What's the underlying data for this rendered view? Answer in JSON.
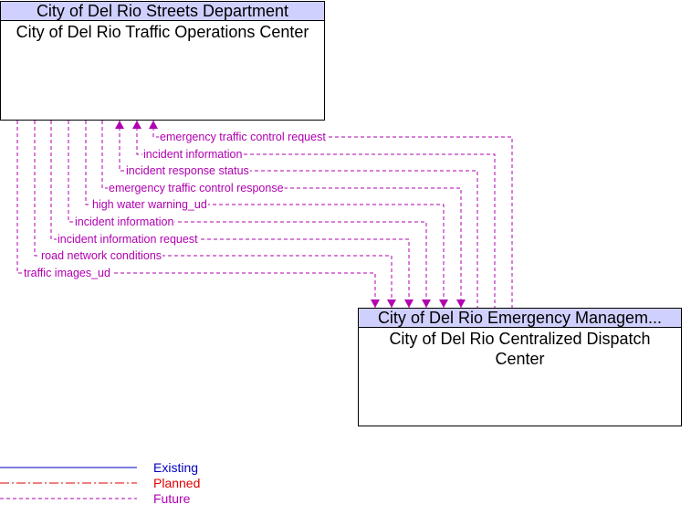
{
  "top_box": {
    "header": "City of Del Rio Streets Department",
    "title": "City of Del Rio Traffic Operations Center"
  },
  "bottom_box": {
    "header": "City of Del Rio Emergency Managem...",
    "title": "City of Del Rio Centralized Dispatch Center"
  },
  "flows": [
    {
      "label": "emergency traffic control request",
      "direction": "to-top",
      "status": "Future"
    },
    {
      "label": "incident information",
      "direction": "to-top",
      "status": "Future"
    },
    {
      "label": "incident response status",
      "direction": "to-top",
      "status": "Future"
    },
    {
      "label": "emergency traffic control response",
      "direction": "to-bottom",
      "status": "Future"
    },
    {
      "label": "high water warning_ud",
      "direction": "to-bottom",
      "status": "Future"
    },
    {
      "label": "incident information",
      "direction": "to-bottom",
      "status": "Future"
    },
    {
      "label": "incident information request",
      "direction": "to-bottom",
      "status": "Future"
    },
    {
      "label": "road network conditions",
      "direction": "to-bottom",
      "status": "Future"
    },
    {
      "label": "traffic images_ud",
      "direction": "to-bottom",
      "status": "Future"
    }
  ],
  "legend": [
    {
      "label": "Existing",
      "color": "#0000c0",
      "style": "solid"
    },
    {
      "label": "Planned",
      "color": "#e00000",
      "style": "dash-dot"
    },
    {
      "label": "Future",
      "color": "#b000b0",
      "style": "dashed"
    }
  ],
  "colors": {
    "future": "#b000b0",
    "header_bg": "#d0d0ff"
  }
}
